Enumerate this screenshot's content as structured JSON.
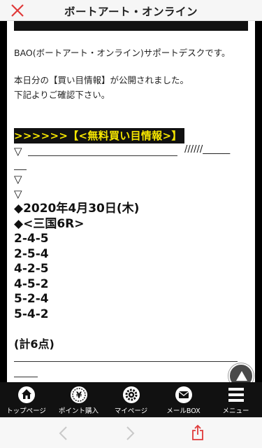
{
  "header": {
    "title": "ボートアート・オンライン"
  },
  "content": {
    "intro_line1": "BAO(ボートアート・オンライン)サポートデスクです。",
    "intro_line2": "本日分の【買い目情報】が公開されました。",
    "intro_line3": "下記よりご確認下さい。",
    "highlight": ">>>>>>【<無料買い目情報>】",
    "arrow": "▽",
    "slashes": "//////______",
    "date": "◆2020年4月30日(木)",
    "race": "◆<三国6R>",
    "picks": [
      "2-4-5",
      "2-5-4",
      "4-2-5",
      "4-5-2",
      "5-2-4",
      "5-4-2"
    ],
    "total": "(計6点)"
  },
  "nav": {
    "items": [
      {
        "label": "トップページ",
        "icon": "home-icon"
      },
      {
        "label": "ポイント購入",
        "icon": "yen-coin-icon"
      },
      {
        "label": "マイページ",
        "icon": "gear-icon"
      },
      {
        "label": "メールBOX",
        "icon": "mail-icon"
      },
      {
        "label": "メニュー",
        "icon": "menu-icon"
      }
    ]
  },
  "colors": {
    "highlight_text": "#f6e600",
    "highlight_bg": "#111111",
    "close_icon": "#e03a3a",
    "share_icon": "#e03a3a"
  }
}
